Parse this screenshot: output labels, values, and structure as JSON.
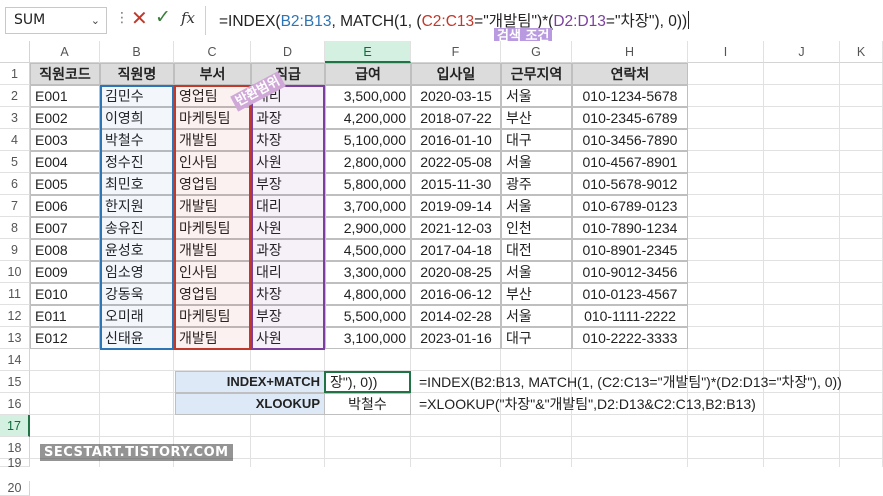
{
  "formula_bar": {
    "name_box": "SUM",
    "formula_prefix": "=INDEX(",
    "ref1": "B2:B13",
    "mid1": ", MATCH(1, (",
    "ref2": "C2:C13",
    "mid2": "=\"개발팀\")*(",
    "ref3": "D2:D13",
    "mid3": "=\"차장\"), 0))",
    "cancel_icon": "close-x-icon",
    "enter_icon": "checkmark-icon",
    "fx_label": "fx"
  },
  "annotations": {
    "return_range": "반환범위",
    "search_condition": "검색 조건"
  },
  "columns": [
    "A",
    "B",
    "C",
    "D",
    "E",
    "F",
    "G",
    "H",
    "I",
    "J",
    "K"
  ],
  "rows": [
    "1",
    "2",
    "3",
    "4",
    "5",
    "6",
    "7",
    "8",
    "9",
    "10",
    "11",
    "12",
    "13",
    "14",
    "15",
    "16",
    "17",
    "18",
    "19",
    "20"
  ],
  "table": {
    "headers": [
      "직원코드",
      "직원명",
      "부서",
      "직급",
      "급여",
      "입사일",
      "근무지역",
      "연락처"
    ],
    "rows": [
      [
        "E001",
        "김민수",
        "영업팀",
        "대리",
        "3,500,000",
        "2020-03-15",
        "서울",
        "010-1234-5678"
      ],
      [
        "E002",
        "이영희",
        "마케팅팀",
        "과장",
        "4,200,000",
        "2018-07-22",
        "부산",
        "010-2345-6789"
      ],
      [
        "E003",
        "박철수",
        "개발팀",
        "차장",
        "5,100,000",
        "2016-01-10",
        "대구",
        "010-3456-7890"
      ],
      [
        "E004",
        "정수진",
        "인사팀",
        "사원",
        "2,800,000",
        "2022-05-08",
        "서울",
        "010-4567-8901"
      ],
      [
        "E005",
        "최민호",
        "영업팀",
        "부장",
        "5,800,000",
        "2015-11-30",
        "광주",
        "010-5678-9012"
      ],
      [
        "E006",
        "한지원",
        "개발팀",
        "대리",
        "3,700,000",
        "2019-09-14",
        "서울",
        "010-6789-0123"
      ],
      [
        "E007",
        "송유진",
        "마케팅팀",
        "사원",
        "2,900,000",
        "2021-12-03",
        "인천",
        "010-7890-1234"
      ],
      [
        "E008",
        "윤성호",
        "개발팀",
        "과장",
        "4,500,000",
        "2017-04-18",
        "대전",
        "010-8901-2345"
      ],
      [
        "E009",
        "임소영",
        "인사팀",
        "대리",
        "3,300,000",
        "2020-08-25",
        "서울",
        "010-9012-3456"
      ],
      [
        "E010",
        "강동욱",
        "영업팀",
        "차장",
        "4,800,000",
        "2016-06-12",
        "부산",
        "010-0123-4567"
      ],
      [
        "E011",
        "오미래",
        "마케팅팀",
        "부장",
        "5,500,000",
        "2014-02-28",
        "서울",
        "010-1111-2222"
      ],
      [
        "E012",
        "신태윤",
        "개발팀",
        "사원",
        "3,100,000",
        "2023-01-16",
        "대구",
        "010-2222-3333"
      ]
    ]
  },
  "lookup": {
    "index_match_label": "INDEX+MATCH",
    "index_match_value": "장\"), 0))",
    "index_match_formula": "=INDEX(B2:B13, MATCH(1, (C2:C13=\"개발팀\")*(D2:D13=\"차장\"), 0))",
    "xlookup_label": "XLOOKUP",
    "xlookup_value": "박철수",
    "xlookup_formula": "=XLOOKUP(\"차장\"&\"개발팀\",D2:D13&C2:C13,B2:B13)"
  },
  "watermark": "SECSTART.TISTORY.COM",
  "colors": {
    "ref_blue": "#2e75b6",
    "ref_red": "#c0392b",
    "ref_purple": "#7b3fa0",
    "excel_green": "#217346",
    "label_fill": "#dde9f7"
  }
}
